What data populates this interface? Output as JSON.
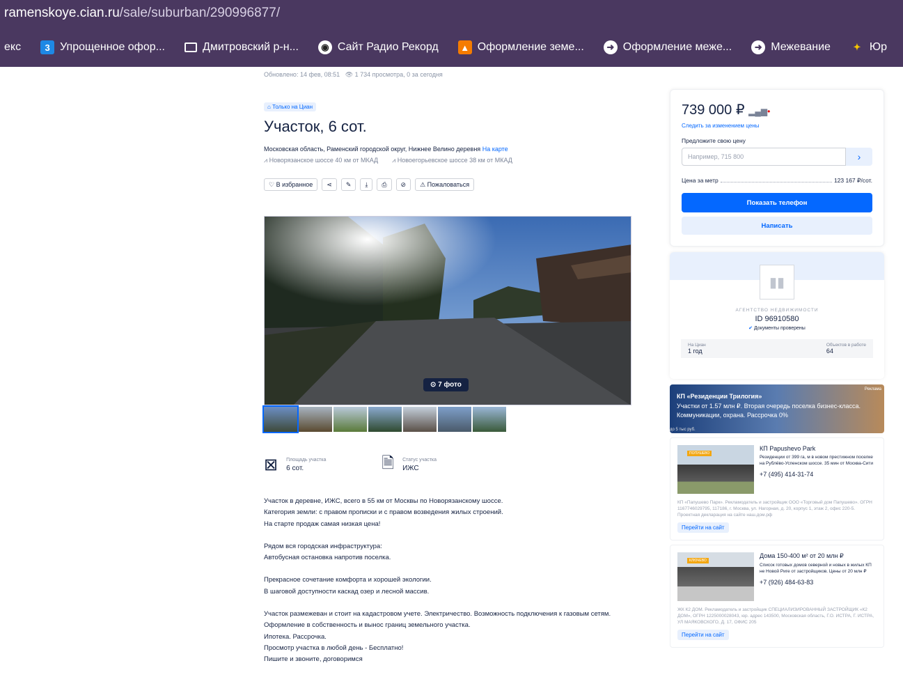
{
  "browser": {
    "url_host": "ramenskoye.cian.ru",
    "url_path": "/sale/suburban/290996877/",
    "bookmarks": [
      {
        "label": "екс",
        "icon": "none"
      },
      {
        "label": "Упрощенное офор...",
        "icon": "number-3-icon"
      },
      {
        "label": "Дмитровский р-н...",
        "icon": "folder-icon"
      },
      {
        "label": "Сайт Радио Рекорд",
        "icon": "radio-record-icon"
      },
      {
        "label": "Оформление земе...",
        "icon": "favicon-orange-icon"
      },
      {
        "label": "Оформление меже...",
        "icon": "favicon-globe-icon"
      },
      {
        "label": "Межевание",
        "icon": "favicon-globe-icon"
      },
      {
        "label": "Юр",
        "icon": "favicon-pin-icon"
      }
    ]
  },
  "listing": {
    "meta_updated": "Обновлено: 14 фев, 08:51",
    "meta_views": "1 734 просмотра, 0 за сегодня",
    "tag": "Только на Циан",
    "title": "Участок, 6 сот.",
    "address": "Московская область, Раменский городской округ, Нижнее Велино деревня",
    "map_link": "На карте",
    "roads": [
      "Новорязанское шоссе  40 км от МКАД",
      "Новоегорьевское шоссе  38 км от МКАД"
    ],
    "actions": {
      "favorite": "В избранное",
      "complain": "Пожаловаться"
    },
    "photo_count": "7 фото",
    "features": [
      {
        "label": "Площадь участка",
        "value": "6 сот."
      },
      {
        "label": "Статус участка",
        "value": "ИЖС"
      }
    ],
    "description": [
      [
        "Участок в деревне, ИЖС, всего в 55 км от Москвы по Новорязанскому шоссе.",
        "Категория земли: с правом прописки и с правом возведения жилых строений.",
        "На старте продаж самая низкая цена!"
      ],
      [
        "Рядом вся городская инфраструктура:",
        "Автобусная остановка напротив поселка."
      ],
      [
        "Прекрасное сочетание комфорта и хорошей экологии.",
        "В шаговой доступности каскад озер и лесной массив."
      ],
      [
        "Участок размежеван и стоит на кадастровом учете. Электричество. Возможность подключения к газовым сетям.",
        "Оформление в собственность и вынос границ земельного участка.",
        "Ипотека. Рассрочка.",
        "Просмотр участка в любой день - Бесплатно!",
        "Пишите и звоните, договоримся"
      ]
    ]
  },
  "sidebar": {
    "price": "739 000 ₽",
    "follow_price": "Следить за изменением цены",
    "offer_label": "Предложите свою цену",
    "offer_placeholder": "Например, 715 800",
    "price_per_m_label": "Цена за метр",
    "price_per_m_value": "123 167 ₽/сот.",
    "show_phone": "Показать телефон",
    "write": "Написать",
    "agency": {
      "type": "АГЕНТСТВО НЕДВИЖИМОСТИ",
      "id": "ID 96910580",
      "verified": "Документы проверены",
      "on_cian_label": "На Циан",
      "on_cian_value": "1 год",
      "objects_label": "Объектов в работе",
      "objects_value": "64"
    },
    "banner": {
      "title": "КП «Резиденции Трилогия»",
      "text": "Участки от 1.57 млн ₽. Вторая очередь поселка бизнес-класса. Коммуникации, охрана. Рассрочка 0%",
      "footnote": "до 5 тыс руб.",
      "ad_label": "Реклама"
    },
    "ads": [
      {
        "badge": "ПОПУШЕВО",
        "title": "КП Papushevo Park",
        "text": "Резиденции от 399 га, м в новом престижном поселке на Рублёво-Успенском шоссе. 35 мин от Москва-Сити",
        "phone": "+7 (495) 414-31-74",
        "legal": "КП «Папушево Парк». Рекламодатель и застройщик ООО «Торговый дом Папушево». ОГРН 1167746029795, 117186, г. Москва, ул. Нагорная, д. 20, корпус 1, этаж 2, офис 220-5. Проектная декларация на сайте наш.дом.рф",
        "link": "Перейти на сайт"
      },
      {
        "badge": "КЛЮЧЕВО",
        "title": "Дома 150-400 м² от 20 млн ₽",
        "text": "Список готовых домов северной и новых в жилых КП не Новой Риге от застройщиков. Цены от 20 млн ₽",
        "phone": "+7 (926) 484-63-83",
        "legal": "ЖК К2 ДОМ. Рекламодатель и застройщик СПЕЦИАЛИЗИРОВАННЫЙ ЗАСТРОЙЩИК «К2 ДОМ», ОГРН 1225000028043, юр. адрес 143500, Московская область, Г.О. ИСТРА, Г. ИСТРА, УЛ МАЯКОВСКОГО, Д. 17, ОФИС 205",
        "link": "Перейти на сайт"
      }
    ]
  }
}
